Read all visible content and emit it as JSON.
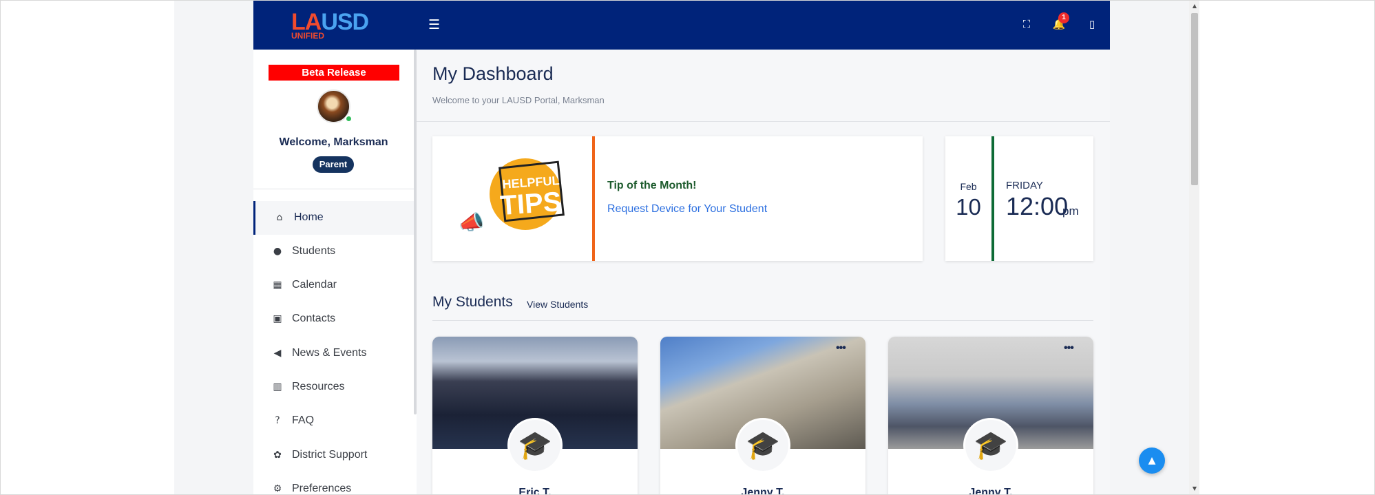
{
  "header": {
    "logo_text_a": "LA",
    "logo_text_b": "USD",
    "logo_sub": "UNIFIED",
    "menu_icon": "hamburger-icon",
    "notification_count": "1"
  },
  "sidebar": {
    "beta_label": "Beta Release",
    "welcome": "Welcome, Marksman",
    "role": "Parent",
    "items": [
      {
        "label": "Home",
        "icon": "home-icon"
      },
      {
        "label": "Students",
        "icon": "user-icon"
      },
      {
        "label": "Calendar",
        "icon": "calendar-icon"
      },
      {
        "label": "Contacts",
        "icon": "contact-card-icon"
      },
      {
        "label": "News & Events",
        "icon": "megaphone-icon"
      },
      {
        "label": "Resources",
        "icon": "books-icon"
      },
      {
        "label": "FAQ",
        "icon": "question-icon"
      },
      {
        "label": "District Support",
        "icon": "lifebuoy-icon"
      },
      {
        "label": "Preferences",
        "icon": "gear-icon"
      }
    ]
  },
  "main": {
    "title": "My Dashboard",
    "subtitle": "Welcome to your LAUSD Portal, Marksman",
    "tip": {
      "art_line1": "HELPFUL",
      "art_line2": "TIPS",
      "title": "Tip of the Month!",
      "link": "Request Device for Your Student"
    },
    "date": {
      "month": "Feb",
      "day": "10",
      "weekday": "FRIDAY",
      "time": "12:00",
      "ampm": "pm"
    },
    "students_section": {
      "title": "My Students",
      "link": "View Students",
      "cards": [
        {
          "name": "Eric T."
        },
        {
          "name": "Jenny T."
        },
        {
          "name": "Jenny T."
        }
      ]
    }
  },
  "colors": {
    "header_bg": "#00237a",
    "beta_red": "#ff0000",
    "tip_accent": "#f06418",
    "date_accent": "#0d6b36",
    "link_blue": "#2c6fe0"
  }
}
